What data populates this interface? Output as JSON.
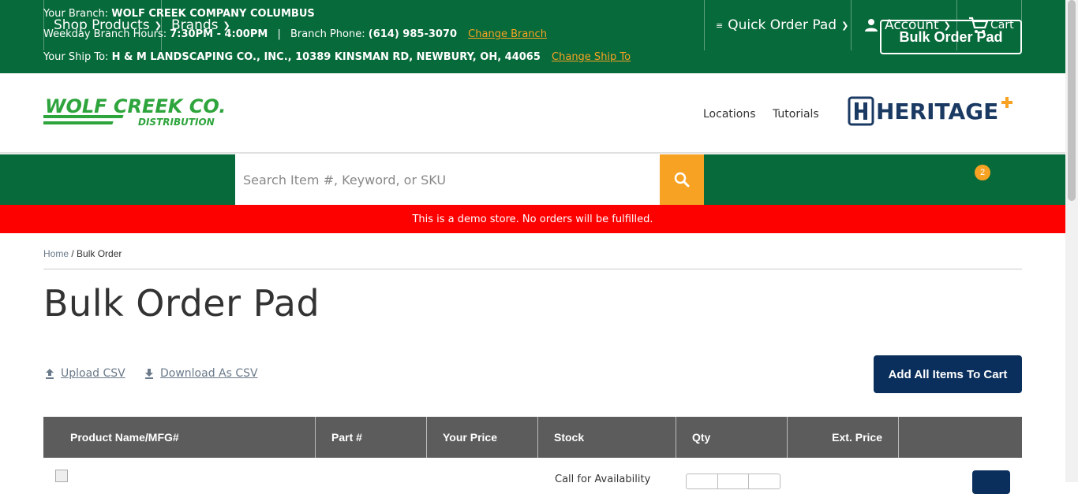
{
  "topbar": {
    "branch_label": "Your Branch:",
    "branch_name": "WOLF CREEK COMPANY COLUMBUS",
    "hours_label": "Weekday Branch Hours:",
    "hours_value": "7:30PM - 4:00PM",
    "separator": "|",
    "phone_label": "Branch Phone:",
    "phone_value": "(614) 985-3070",
    "change_branch": "Change Branch",
    "shipto_label": "Your Ship To:",
    "shipto_value": "H & M LANDSCAPING CO., INC., 10389 KINSMAN RD, NEWBURY, OH, 44065",
    "change_shipto": "Change Ship To",
    "bulk_order_button": "Bulk Order Pad"
  },
  "header": {
    "logo_main": "WOLF CREEK CO.",
    "logo_sub": "DISTRIBUTION",
    "links": [
      "Locations",
      "Tutorials"
    ],
    "partner_logo": "HERITAGE"
  },
  "nav": {
    "shop_products": "Shop Products",
    "brands": "Brands",
    "search_placeholder": "Search Item #, Keyword, or SKU",
    "quick_order": "Quick Order Pad",
    "account": "Account",
    "cart": "Cart",
    "cart_count": "2"
  },
  "demo_banner": "This is a demo store. No orders will be fulfilled.",
  "breadcrumb": {
    "home": "Home",
    "separator": "/",
    "current": "Bulk Order"
  },
  "page_title": "Bulk Order Pad",
  "actions": {
    "upload_csv": "Upload CSV",
    "download_csv": "Download As CSV",
    "add_all": "Add All Items To Cart"
  },
  "table": {
    "headers": [
      "Product Name/MFG#",
      "Part #",
      "Your Price",
      "Stock",
      "Qty",
      "Ext. Price"
    ],
    "rows": [
      {
        "stock": "Call for Availability"
      }
    ]
  },
  "colors": {
    "brand_green": "#076a3a",
    "accent_orange": "#f7a223",
    "navy": "#0a2f5c",
    "demo_red": "#fd0000"
  }
}
